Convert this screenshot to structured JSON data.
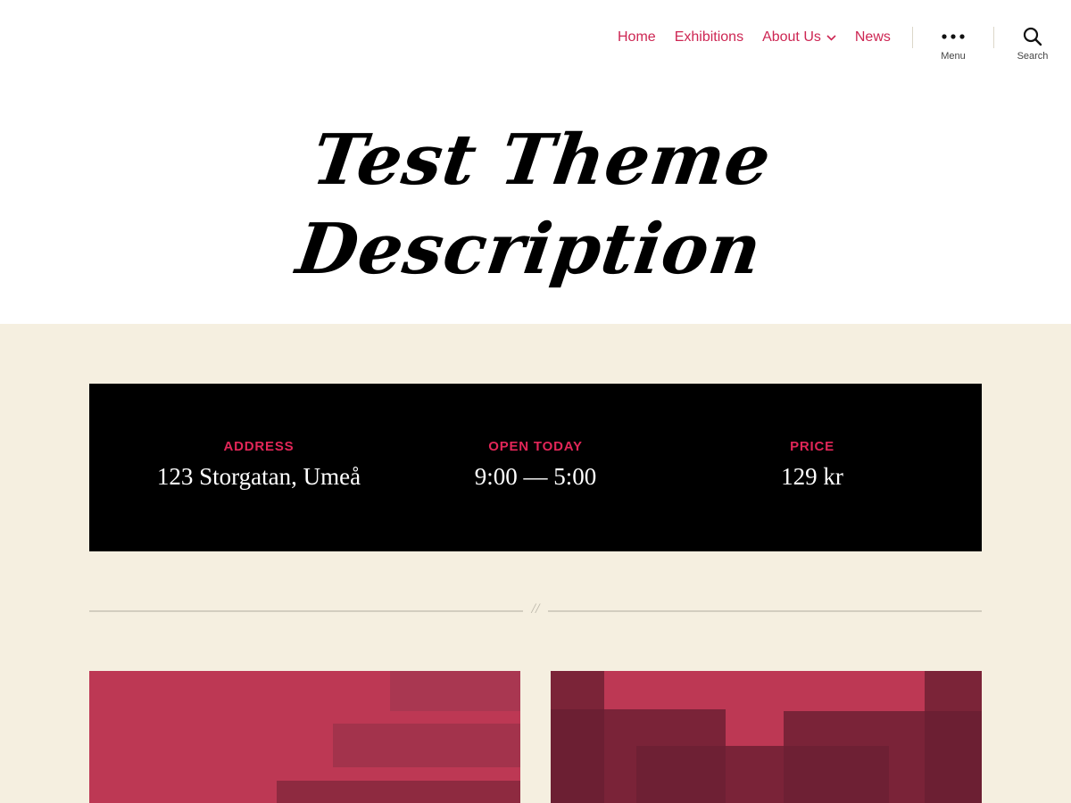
{
  "nav": {
    "items": [
      {
        "label": "Home"
      },
      {
        "label": "Exhibitions"
      },
      {
        "label": "About Us"
      },
      {
        "label": "News"
      }
    ]
  },
  "tools": {
    "menu_label": "Menu",
    "search_label": "Search",
    "menu_icon": "ellipsis-icon",
    "search_icon": "search-icon"
  },
  "site": {
    "title": "Test Theme Description"
  },
  "info": {
    "address_label": "ADDRESS",
    "address_value": "123 Storgatan, Umeå",
    "hours_label": "OPEN TODAY",
    "hours_value": "9:00 — 5:00",
    "price_label": "PRICE",
    "price_value": "129 kr"
  },
  "separator": {
    "mark": "//"
  },
  "colors": {
    "accent": "#cd2653",
    "background": "#f5efe0",
    "header": "#ffffff",
    "info_bar": "#000000"
  }
}
